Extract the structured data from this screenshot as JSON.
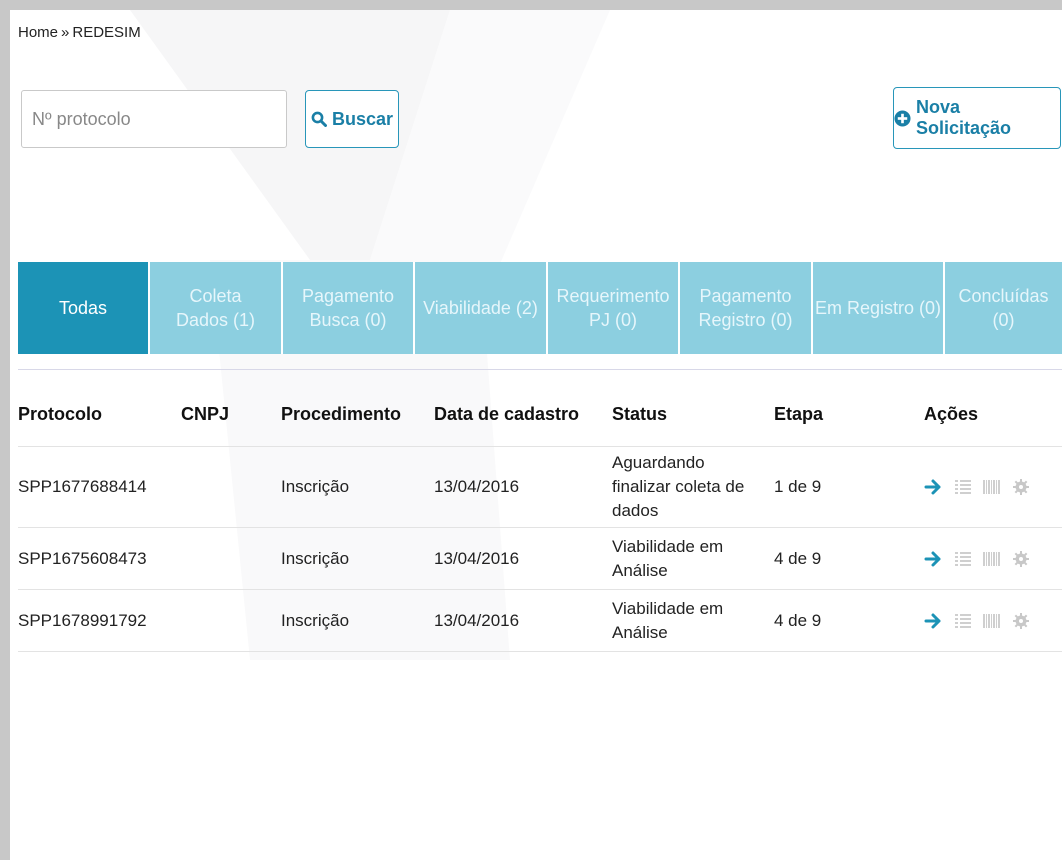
{
  "breadcrumb": {
    "home": "Home",
    "separator": "»",
    "current": "REDESIM"
  },
  "search": {
    "placeholder": "Nº protocolo",
    "value": "",
    "button_label": "Buscar",
    "icon": "search-icon"
  },
  "new_request": {
    "label": "Nova Solicitação",
    "icon": "plus-circle-icon"
  },
  "tabs": [
    {
      "label": "Todas",
      "active": true
    },
    {
      "label": "Coleta\nDados (1)",
      "active": false
    },
    {
      "label": "Pagamento\nBusca (0)",
      "active": false
    },
    {
      "label": "Viabilidade (2)",
      "active": false
    },
    {
      "label": "Requerimento\nPJ (0)",
      "active": false
    },
    {
      "label": "Pagamento\nRegistro (0)",
      "active": false
    },
    {
      "label": "Em Registro (0)",
      "active": false
    },
    {
      "label": "Concluídas (0)",
      "active": false
    }
  ],
  "table": {
    "headers": {
      "protocolo": "Protocolo",
      "cnpj": "CNPJ",
      "procedimento": "Procedimento",
      "data": "Data de cadastro",
      "status": "Status",
      "etapa": "Etapa",
      "acoes": "Ações"
    },
    "rows": [
      {
        "protocolo": "SPP1677688414",
        "cnpj": "",
        "procedimento": "Inscrição",
        "data": "13/04/2016",
        "status": "Aguardando finalizar coleta de dados",
        "etapa": "1 de 9"
      },
      {
        "protocolo": "SPP1675608473",
        "cnpj": "",
        "procedimento": "Inscrição",
        "data": "13/04/2016",
        "status": "Viabilidade em Análise",
        "etapa": "4 de 9"
      },
      {
        "protocolo": "SPP1678991792",
        "cnpj": "",
        "procedimento": "Inscrição",
        "data": "13/04/2016",
        "status": "Viabilidade em Análise",
        "etapa": "4 de 9"
      }
    ],
    "action_icons": [
      "arrow-right-icon",
      "list-icon",
      "barcode-icon",
      "gear-icon"
    ]
  },
  "colors": {
    "accent": "#1c93b6",
    "tab_inactive": "#8ccfe0",
    "button_border": "#2896b9",
    "action_arrow": "#1c93b6",
    "action_disabled": "#c8c8c8"
  }
}
